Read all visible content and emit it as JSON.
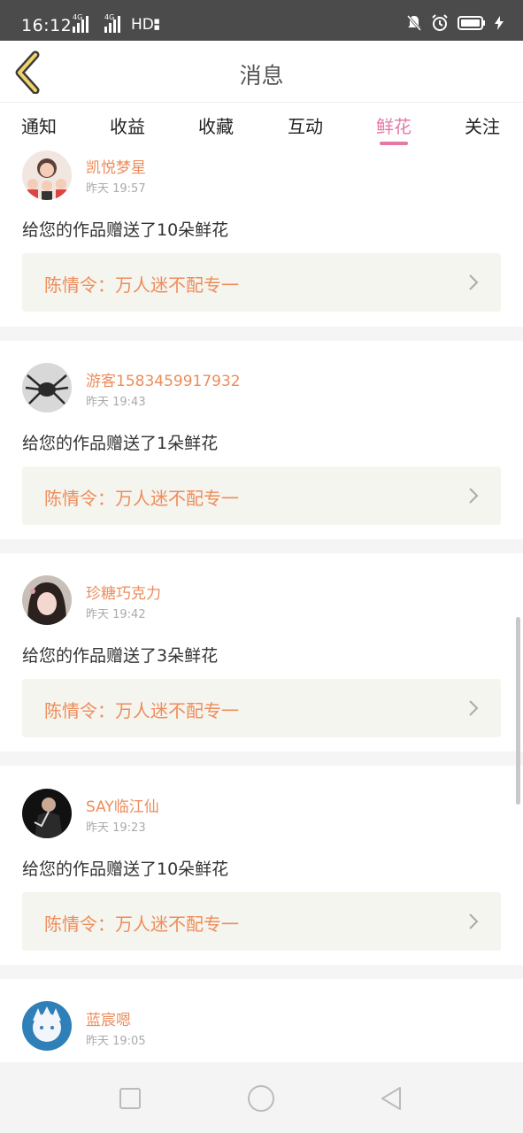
{
  "status_bar": {
    "time": "16:12",
    "net1": "4G",
    "net2": "4G",
    "hd": "HD"
  },
  "header": {
    "title": "消息"
  },
  "tabs": [
    {
      "label": "通知",
      "active": false
    },
    {
      "label": "收益",
      "active": false
    },
    {
      "label": "收藏",
      "active": false
    },
    {
      "label": "互动",
      "active": false
    },
    {
      "label": "鲜花",
      "active": true
    },
    {
      "label": "关注",
      "active": false
    }
  ],
  "messages": [
    {
      "username": "凯悦梦星",
      "time": "昨天 19:57",
      "text": "给您的作品赠送了10朵鲜花",
      "work_title": "陈情令：万人迷不配专一"
    },
    {
      "username": "游客1583459917932",
      "time": "昨天 19:43",
      "text": "给您的作品赠送了1朵鲜花",
      "work_title": "陈情令：万人迷不配专一"
    },
    {
      "username": "珍糖巧克力",
      "time": "昨天 19:42",
      "text": "给您的作品赠送了3朵鲜花",
      "work_title": "陈情令：万人迷不配专一"
    },
    {
      "username": "SAY临江仙",
      "time": "昨天 19:23",
      "text": "给您的作品赠送了10朵鲜花",
      "work_title": "陈情令：万人迷不配专一"
    },
    {
      "username": "蓝宸嗯",
      "time": "昨天 19:05",
      "text": "",
      "work_title": ""
    }
  ],
  "colors": {
    "accent_pink": "#e27aa5",
    "username_orange": "#ee8c5a",
    "status_bar_bg": "#4b4b4b",
    "card_link_bg": "#f5f5ef"
  },
  "icons": {
    "back": "back-chevron-icon",
    "chevron": "chevron-right-icon",
    "nav": [
      "square-recents-icon",
      "circle-home-icon",
      "triangle-back-icon"
    ]
  }
}
